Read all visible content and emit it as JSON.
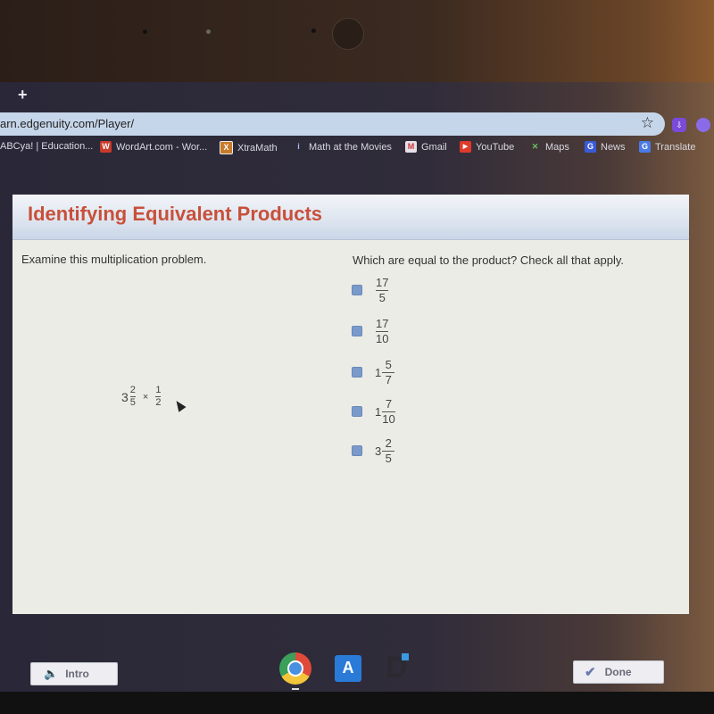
{
  "browser": {
    "new_tab_label": "+",
    "url": "arn.edgenuity.com/Player/",
    "bookmark_star": "☆",
    "bookmarks": [
      {
        "label": "ABCya! | Education...",
        "icon": "abcya-icon"
      },
      {
        "label": "WordArt.com - Wor...",
        "icon": "wordart-icon",
        "glyph": "W"
      },
      {
        "label": "XtraMath",
        "icon": "xtramath-icon",
        "glyph": "X"
      },
      {
        "label": "Math at the Movies",
        "icon": "info-icon",
        "glyph": "i"
      },
      {
        "label": "Gmail",
        "icon": "gmail-icon",
        "glyph": "M"
      },
      {
        "label": "YouTube",
        "icon": "youtube-icon",
        "glyph": "▶"
      },
      {
        "label": "Maps",
        "icon": "maps-icon",
        "glyph": "✕"
      },
      {
        "label": "News",
        "icon": "news-icon",
        "glyph": "G"
      },
      {
        "label": "Translate",
        "icon": "translate-icon",
        "glyph": "G"
      }
    ]
  },
  "player": {
    "title": "Identifying Equivalent Products",
    "left_instruction": "Examine this multiplication problem.",
    "right_instruction": "Which are equal to the product? Check all that apply.",
    "problem": {
      "whole": "3",
      "numerator1": "2",
      "denominator1": "5",
      "operator": "×",
      "numerator2": "1",
      "denominator2": "2"
    },
    "options": [
      {
        "whole": "",
        "numerator": "17",
        "denominator": "5",
        "checked": false
      },
      {
        "whole": "",
        "numerator": "17",
        "denominator": "10",
        "checked": false
      },
      {
        "whole": "1",
        "numerator": "5",
        "denominator": "7",
        "checked": false
      },
      {
        "whole": "1",
        "numerator": "7",
        "denominator": "10",
        "checked": false
      },
      {
        "whole": "3",
        "numerator": "2",
        "denominator": "5",
        "checked": false
      }
    ],
    "intro_button": "Intro",
    "done_button": "Done"
  },
  "shelf": {
    "apps": [
      "chrome-icon",
      "aa-app-icon",
      "d-app-icon"
    ],
    "aa_glyph": "A",
    "d_glyph": "D"
  },
  "colors": {
    "title": "#c8503a",
    "checkbox": "#7a9acc"
  }
}
